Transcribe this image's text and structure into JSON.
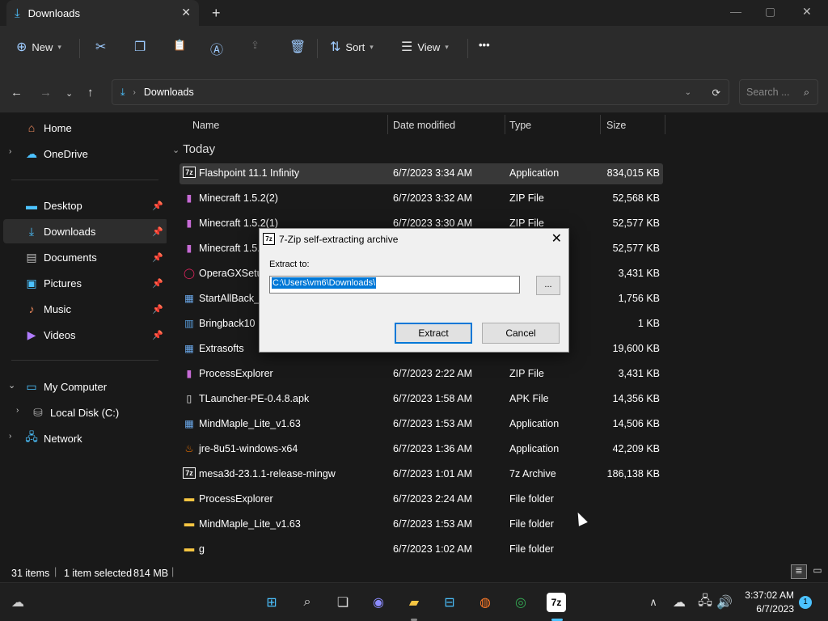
{
  "window": {
    "tab_title": "Downloads",
    "new_tab": "+",
    "minimize": "—",
    "maximize": "▢",
    "close": "✕"
  },
  "commandbar": {
    "new_label": "New",
    "sort_label": "Sort",
    "view_label": "View",
    "more": "•••"
  },
  "address": {
    "path_segment": "Downloads",
    "search_placeholder": "Search ..."
  },
  "sidebar": {
    "home": "Home",
    "onedrive": "OneDrive",
    "quick": [
      {
        "label": "Desktop"
      },
      {
        "label": "Downloads"
      },
      {
        "label": "Documents"
      },
      {
        "label": "Pictures"
      },
      {
        "label": "Music"
      },
      {
        "label": "Videos"
      }
    ],
    "mycomputer": "My Computer",
    "localdisk": "Local Disk (C:)",
    "network": "Network"
  },
  "columns": {
    "name": "Name",
    "date": "Date modified",
    "type": "Type",
    "size": "Size"
  },
  "group_today": "Today",
  "files": [
    {
      "name": "Flashpoint 11.1 Infinity",
      "date": "6/7/2023 3:34 AM",
      "type": "Application",
      "size": "834,015 KB",
      "icon": "7z-icon"
    },
    {
      "name": "Minecraft 1.5.2(2)",
      "date": "6/7/2023 3:32 AM",
      "type": "ZIP File",
      "size": "52,568 KB",
      "icon": "zip-icon"
    },
    {
      "name": "Minecraft 1.5.2(1)",
      "date": "6/7/2023 3:30 AM",
      "type": "ZIP File",
      "size": "52,577 KB",
      "icon": "zip-icon"
    },
    {
      "name": "Minecraft 1.5.2",
      "date": "",
      "type": "",
      "size": "52,577 KB",
      "icon": "zip-icon"
    },
    {
      "name": "OperaGXSetup",
      "date": "",
      "type": "",
      "size": "3,431 KB",
      "icon": "opera-icon"
    },
    {
      "name": "StartAllBack_3",
      "date": "",
      "type": "",
      "size": "1,756 KB",
      "icon": "app-icon"
    },
    {
      "name": "Bringback10",
      "date": "",
      "type": "ntries",
      "size": "1 KB",
      "icon": "reg-icon"
    },
    {
      "name": "Extrasofts",
      "date": "",
      "type": "",
      "size": "19,600 KB",
      "icon": "app-icon"
    },
    {
      "name": "ProcessExplorer",
      "date": "6/7/2023 2:22 AM",
      "type": "ZIP File",
      "size": "3,431 KB",
      "icon": "zip-icon"
    },
    {
      "name": "TLauncher-PE-0.4.8.apk",
      "date": "6/7/2023 1:58 AM",
      "type": "APK File",
      "size": "14,356 KB",
      "icon": "file-icon"
    },
    {
      "name": "MindMaple_Lite_v1.63",
      "date": "6/7/2023 1:53 AM",
      "type": "Application",
      "size": "14,506 KB",
      "icon": "app-icon"
    },
    {
      "name": "jre-8u51-windows-x64",
      "date": "6/7/2023 1:36 AM",
      "type": "Application",
      "size": "42,209 KB",
      "icon": "java-icon"
    },
    {
      "name": "mesa3d-23.1.1-release-mingw",
      "date": "6/7/2023 1:01 AM",
      "type": "7z Archive",
      "size": "186,138 KB",
      "icon": "7z-icon"
    },
    {
      "name": "ProcessExplorer",
      "date": "6/7/2023 2:24 AM",
      "type": "File folder",
      "size": "",
      "icon": "folder-icon"
    },
    {
      "name": "MindMaple_Lite_v1.63",
      "date": "6/7/2023 1:53 AM",
      "type": "File folder",
      "size": "",
      "icon": "folder-icon"
    },
    {
      "name": "g",
      "date": "6/7/2023 1:02 AM",
      "type": "File folder",
      "size": "",
      "icon": "folder-icon"
    }
  ],
  "status": {
    "items": "31 items",
    "selected": "1 item selected",
    "size": "814 MB"
  },
  "dialog": {
    "title": "7-Zip self-extracting archive",
    "icon_text": "7z",
    "extract_to_label": "Extract to:",
    "path_value": "C:\\Users\\vm6\\Downloads\\",
    "browse": "...",
    "extract": "Extract",
    "cancel": "Cancel"
  },
  "taskbar": {
    "time": "3:37:02 AM",
    "date": "6/7/2023",
    "notif": "1"
  }
}
